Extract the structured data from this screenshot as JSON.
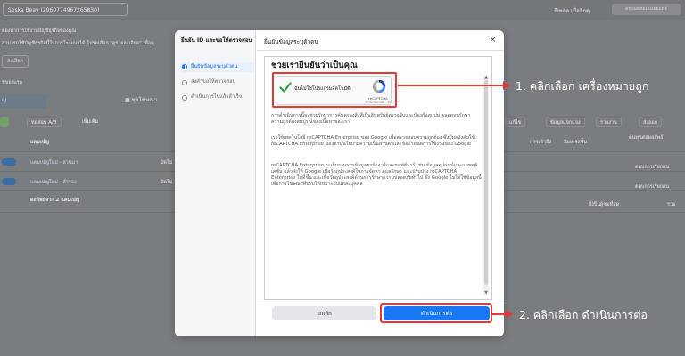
{
  "background": {
    "account_name": "Seska Beay (2060774967265830)",
    "top_right_text": "อีเพลต เมื่อลิกคุ",
    "top_right_button": "ตรวจสอบและเผยแพร่",
    "notice_line1": "ต้องทำการใช้งานบัญชีธุรกิจของคุณ",
    "notice_line2": "สามารถใช้บัญชีธุรกิจนี้ในการโฆษณาได้ โปรดเลือก \"ดูรายละเอียด\" เพื่อดู",
    "notice_button": "ละเอียด",
    "section_label": "แคมเปญ",
    "search_hint": "ขของแรก",
    "active_tab": "ญ",
    "tab_adsets": "ชุดโฆษณา",
    "toolbar_left1": "ทดสอบ A/B",
    "toolbar_left2": "เพิ่มเติม",
    "toolbar_right": [
      "แก้ไข",
      "ข้อมูลแจกแจง",
      "รายงาน",
      "ส่งออก"
    ],
    "col_campaign": "แคมเปญ",
    "col_right": [
      "การเข้าถึง",
      "อิมเพรสชั่น",
      "ต้นทุนต่อผลลัพธ์"
    ],
    "row1": "แคมเปญใหม่ - สวนมา",
    "row2": "แคมเปญใหม่ - สำรอง",
    "row_status": "ปิดไม่",
    "row_summary": "ผลลัพธ์จาก 2 แคมเปญ",
    "row_note1": "ตอบการเรียกผน",
    "row_note2": "ตอบการเรียกผน",
    "row_note3": "ยิ่ง้ป็นผู้ชมที่สุด",
    "row_note4": "รวม"
  },
  "sidebar": {
    "title": "ยืนยัน ID และขอให้ตรวจสอบ",
    "steps": [
      {
        "label": "ยืนยันข้อมูลระบุตัวตน",
        "active": true
      },
      {
        "label": "ส่งคำขอให้ตรวจสอบ",
        "active": false
      },
      {
        "label": "ดำเนินการไปแล้วสำเร็จ",
        "active": false
      }
    ]
  },
  "modal": {
    "title": "ยืนยันข้อมูลระบุตัวตน",
    "close_label": "×",
    "heading": "ช่วยเรายืนยันว่าเป็นคุณ",
    "recaptcha": {
      "checkbox_label": "ฉันไม่ใช่โปรแกรมอัตโนมัติ",
      "brand": "reCAPTCHA",
      "terms": "ความเป็นส่วนตัว - ข้อกำหนด"
    },
    "paragraph1": "การดำเนินการนี้จะช่วยรักษาการคุ้มครองสิ่งที่เป็นสินทรัพย์ตรวจจับและป้องกันสแปม ตลอดจนรักษาความถูกต้องสมบูรณ์ของเนื้อหาของเรา",
    "paragraph2": "เราใช้เทคโนโลยี reCAPTCHA Enterprise ของ Google เพื่อตรวจสอบความถูกต้อง ซึ่งมีผลบังคับใช้ reCAPTCHA Enterprise ของตามนโยบายความเป็นส่วนตัวและข้อกำหนดการใช้งานของ Google",
    "paragraph3": "reCAPTCHA Enterprise จะเก็บรวบรวมข้อมูลฮาร์ดแวร์และซอฟต์แวร์ เช่น ข้อมูลอุปกรณ์และแอพพลิเคชั่น แล้วส่งให้ Google เพื่อวัตถุประสงค์ในการจัดหา ดูแลรักษา และปรับปรุง reCAPTCHA Enterprise ให้ดีขึ้น และเพื่อวัตถุประสงค์ด้านการรักษาความปลอดภัยทั่วไป ซึ่ง Google ไม่ได้ใช้ข้อมูลนี้เพื่อการโฆษณาที่ปรับให้เหมาะกับแต่ละบุคคล",
    "cancel_label": "ยกเลิก",
    "continue_label": "ดำเนินการต่อ"
  },
  "annotations": {
    "step1": "1. คลิกเลือก เครื่องหมายถูก",
    "step2": "2. คลิกเลือก ดำเนินการต่อ",
    "color": "#e53935"
  }
}
